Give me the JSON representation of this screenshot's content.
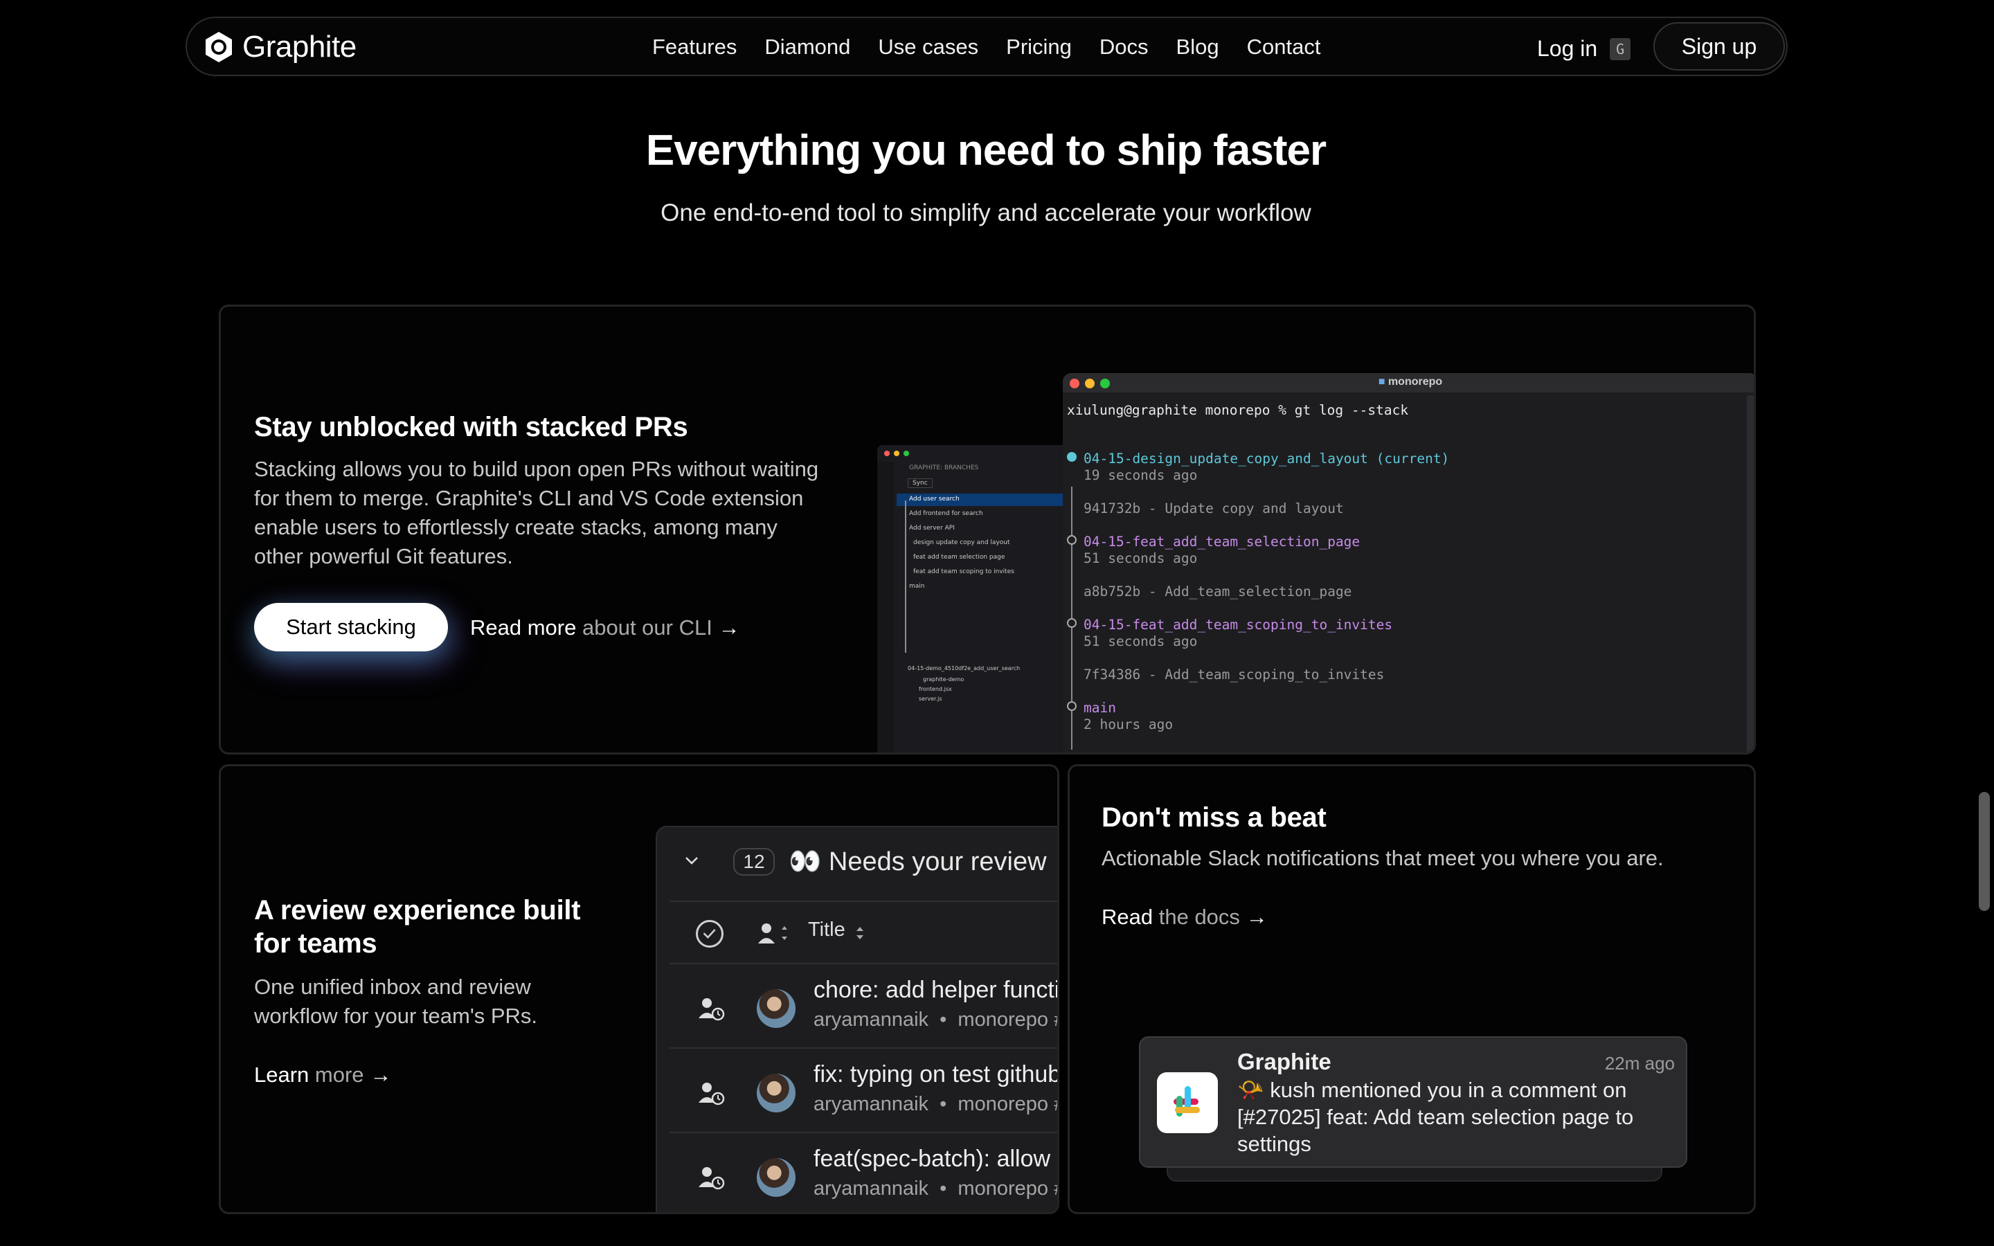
{
  "nav": {
    "logo": "Graphite",
    "links": [
      "Features",
      "Diamond",
      "Use cases",
      "Pricing",
      "Docs",
      "Blog",
      "Contact"
    ],
    "login": "Log in",
    "login_key": "G",
    "signup": "Sign up"
  },
  "hero": {
    "title": "Everything you need to ship faster",
    "subtitle": "One end-to-end tool to simplify and accelerate your workflow"
  },
  "stack_card": {
    "title": "Stay unblocked with stacked PRs",
    "body": "Stacking allows you to build upon open PRs without waiting for them to merge. Graphite's CLI and VS Code extension enable users to effortlessly create stacks, among many other powerful Git features.",
    "cta": "Start stacking",
    "link_strong": "Read more",
    "link_muted": "about our CLI",
    "arrow": "→"
  },
  "vscode": {
    "header": "GRAPHITE: BRANCHES",
    "sync": "Sync",
    "branches": [
      "Add user search",
      "Add frontend for search",
      "Add server API",
      "design update copy and layout",
      "feat add team selection page",
      "feat add team scoping to invites",
      "main"
    ],
    "repo_line": "04-15-demo_4510df2e_add_user_search",
    "folder": "graphite-demo",
    "files": [
      "frontend.jsx",
      "server.js"
    ]
  },
  "terminal": {
    "title": "monorepo",
    "prompt": "xiulung@graphite monorepo % gt log --stack",
    "entries": [
      {
        "branch": "04-15-design_update_copy_and_layout (current)",
        "age": "19 seconds ago",
        "commit": "941732b - Update copy and layout",
        "color": "#5ec8d8"
      },
      {
        "branch": "04-15-feat_add_team_selection_page",
        "age": "51 seconds ago",
        "commit": "a8b752b - Add_team_selection_page",
        "color": "#c68be6"
      },
      {
        "branch": "04-15-feat_add_team_scoping_to_invites",
        "age": "51 seconds ago",
        "commit": "7f34386 - Add_team_scoping_to_invites",
        "color": "#c68be6"
      },
      {
        "branch": "main",
        "age": "2 hours ago",
        "commit": "",
        "color": "#c68be6"
      }
    ]
  },
  "review_card": {
    "title": "A review experience built for teams",
    "body": "One unified inbox and review workflow for your team's PRs.",
    "link_strong": "Learn",
    "link_muted": "more",
    "arrow": "→"
  },
  "review_panel": {
    "count": "12",
    "heading": "👀 Needs your review",
    "column_title": "Title",
    "rows": [
      {
        "title": "chore: add helper functi",
        "author": "aryamannaik",
        "repo": "monorepo #"
      },
      {
        "title": "fix: typing on test github",
        "author": "aryamannaik",
        "repo": "monorepo #"
      },
      {
        "title": "feat(spec-batch): allow l",
        "author": "aryamannaik",
        "repo": "monorepo #"
      }
    ]
  },
  "slack_card": {
    "title": "Don't miss a beat",
    "body": "Actionable Slack notifications that meet you where you are.",
    "link_strong": "Read",
    "link_muted": "the docs",
    "arrow": "→"
  },
  "slack_notification": {
    "app": "Graphite",
    "time": "22m ago",
    "message": "📯 kush mentioned you in a comment on [#27025] feat: Add team selection page to settings"
  }
}
